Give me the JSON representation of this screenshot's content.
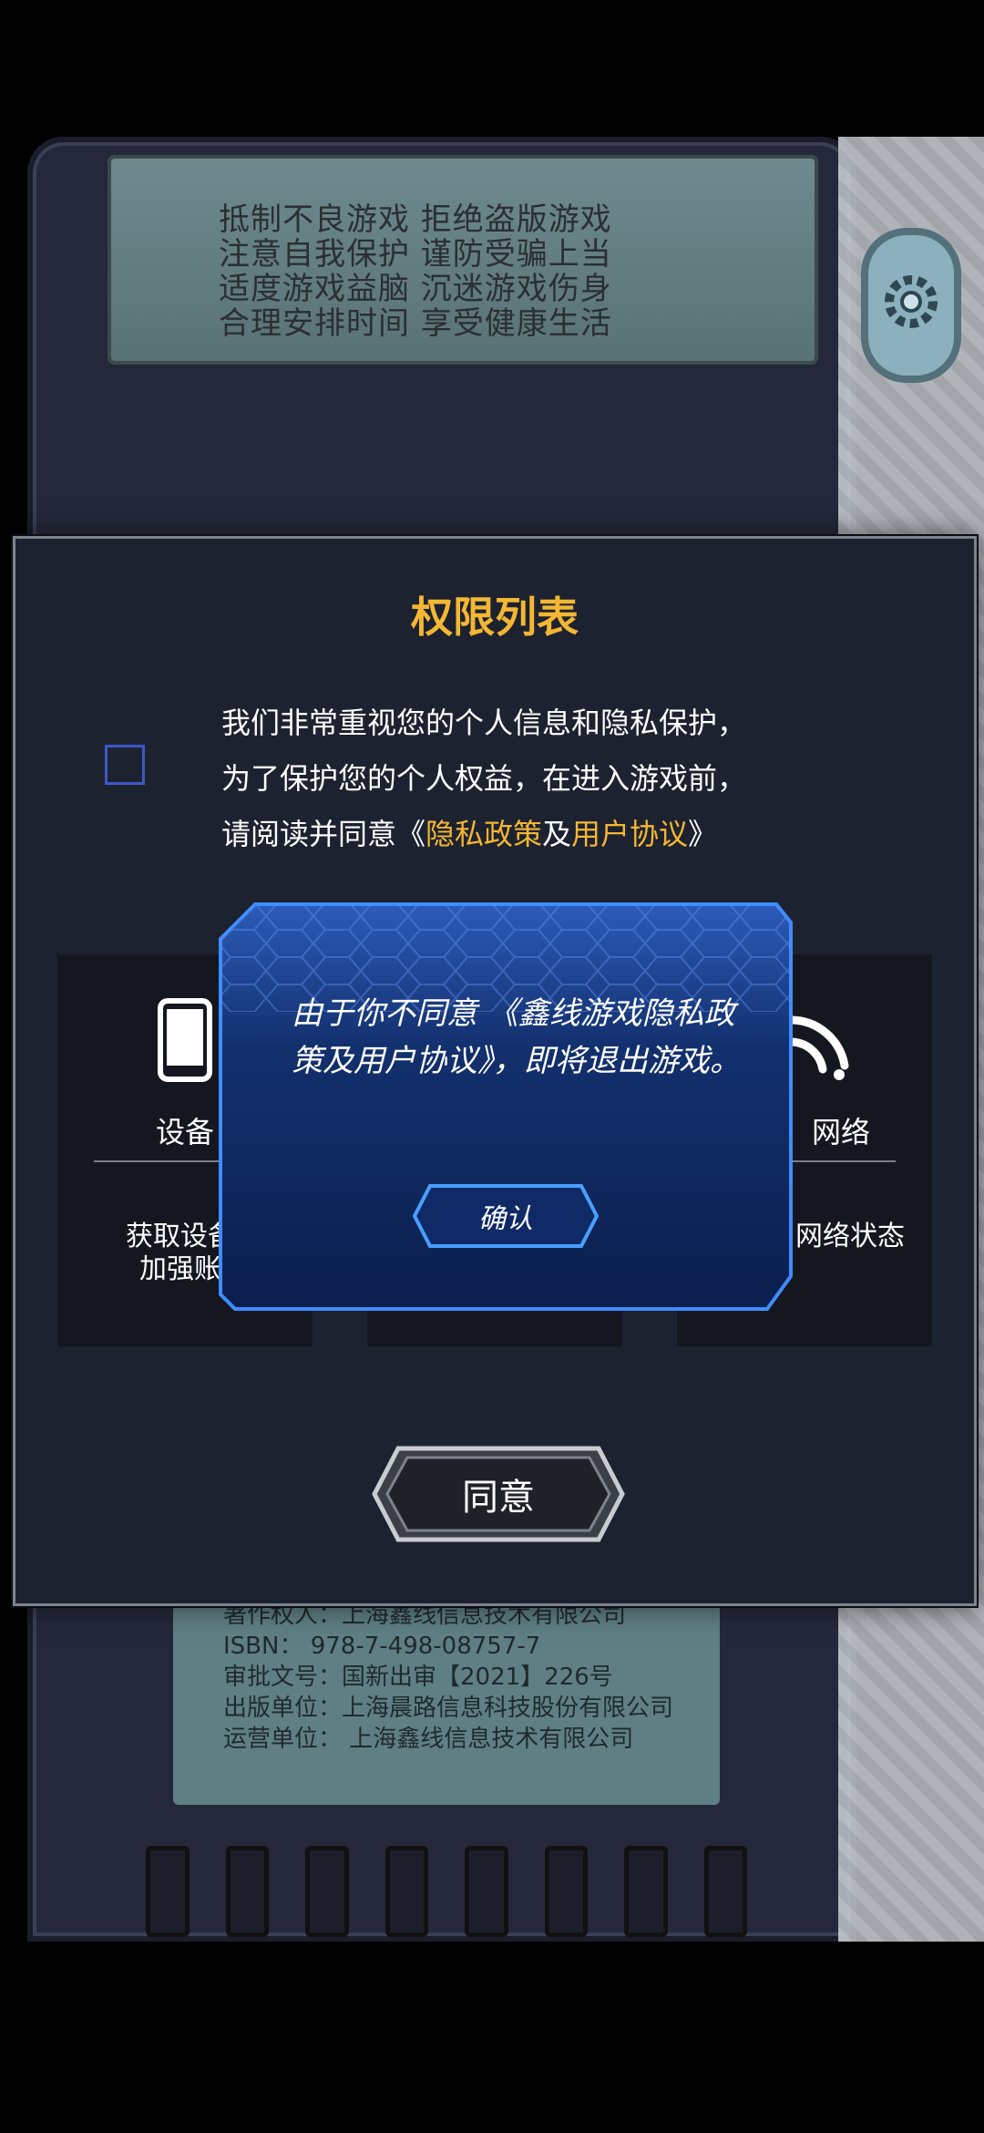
{
  "background": {
    "slogans": [
      "抵制不良游戏  拒绝盗版游戏",
      "注意自我保护  谨防受骗上当",
      "适度游戏益脑  沉迷游戏伤身",
      "合理安排时间  享受健康生活"
    ],
    "credits": [
      "著作权人：上海鑫线信息技术有限公司",
      "ISBN：    978-7-498-08757-7",
      "审批文号：国新出审【2021】226号",
      "出版单位：上海晨路信息科技股份有限公司",
      "运营单位：  上海鑫线信息技术有限公司"
    ],
    "settings_icon": "gear-icon"
  },
  "panel": {
    "title": "权限列表",
    "notice_line1": "我们非常重视您的个人信息和隐私保护，",
    "notice_line2": "为了保护您的个人权益，在进入游戏前，",
    "notice_line3_prefix": "请阅读并同意《",
    "privacy_link": "隐私政策",
    "and": "及",
    "agreement_link": "用户协议",
    "notice_line3_suffix": "》",
    "agree_checked": false,
    "permissions": [
      {
        "name": "设备",
        "desc_line1": "获取设备标",
        "desc_line2": "加强账号",
        "icon": "phone-icon"
      },
      {
        "name": "",
        "desc_line1": "",
        "desc_line2": "",
        "icon": ""
      },
      {
        "name": "网络",
        "desc_line1": "网络状态",
        "desc_line2": "",
        "icon": "wifi-icon"
      }
    ],
    "agree_button": "同意"
  },
  "modal": {
    "message": "由于你不同意 《鑫线游戏隐私政策及用户协议》，即将退出游戏。",
    "confirm_button": "确认"
  },
  "colors": {
    "accent": "#f3b733",
    "modal_border": "#3f8cff",
    "checkbox": "#3d57c8"
  }
}
